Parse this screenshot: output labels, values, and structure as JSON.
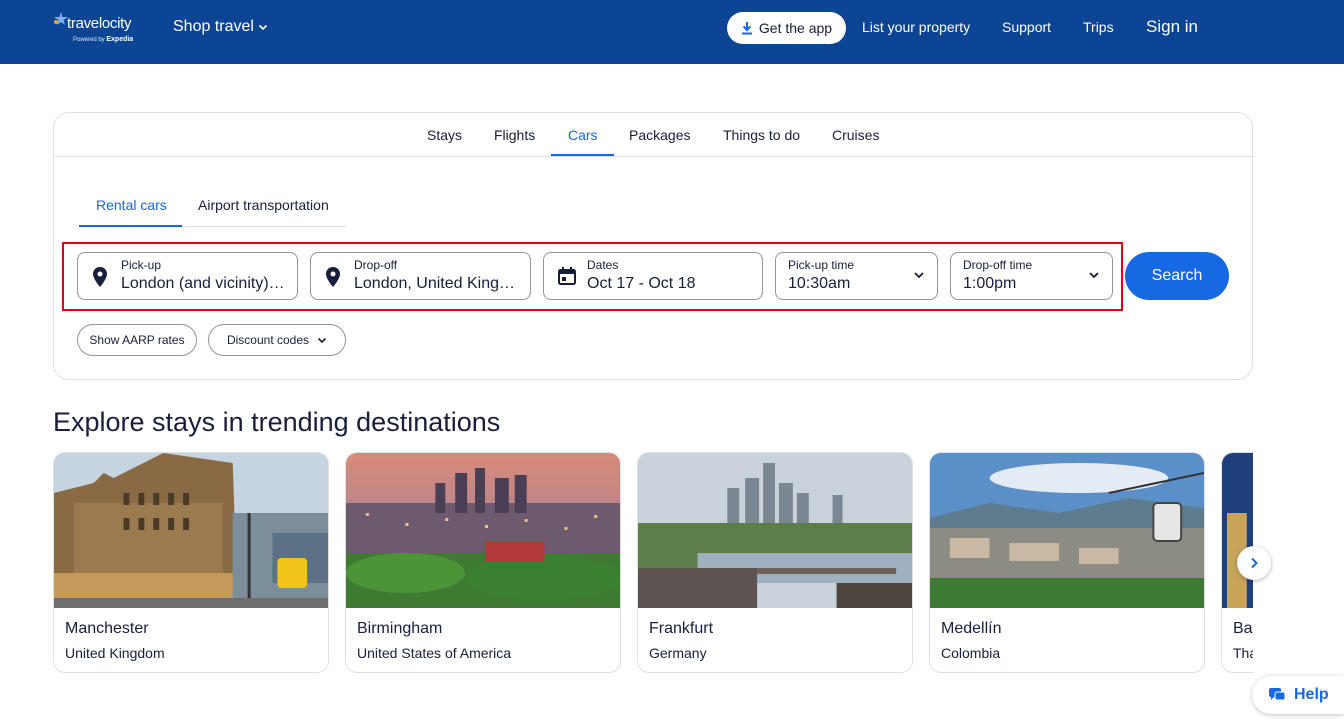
{
  "header": {
    "logo_name": "travelocity",
    "logo_powered": "Powered by",
    "logo_brand": "Expedia",
    "shop_travel": "Shop travel",
    "get_app": "Get the app",
    "list_property": "List your property",
    "support": "Support",
    "trips": "Trips",
    "sign_in": "Sign in",
    "bg_color": "#0d4595"
  },
  "tabs": [
    {
      "label": "Stays"
    },
    {
      "label": "Flights"
    },
    {
      "label": "Cars",
      "active": true
    },
    {
      "label": "Packages"
    },
    {
      "label": "Things to do"
    },
    {
      "label": "Cruises"
    }
  ],
  "subtabs": [
    {
      "label": "Rental cars",
      "active": true
    },
    {
      "label": "Airport transportation"
    }
  ],
  "form": {
    "pickup": {
      "label": "Pick-up",
      "value": "London (and vicinity)…",
      "icon": "map-pin-icon"
    },
    "dropoff": {
      "label": "Drop-off",
      "value": "London, United King…",
      "icon": "map-pin-icon"
    },
    "dates": {
      "label": "Dates",
      "value": "Oct 17 - Oct 18",
      "icon": "calendar-icon"
    },
    "pickup_time": {
      "label": "Pick-up time",
      "value": "10:30am"
    },
    "dropoff_time": {
      "label": "Drop-off time",
      "value": "1:00pm"
    },
    "search": "Search",
    "aarp": "Show AARP rates",
    "discount": "Discount codes",
    "accent_color": "#1668e3",
    "highlight_color": "#e60012"
  },
  "trending": {
    "heading": "Explore stays in trending destinations",
    "destinations": [
      {
        "city": "Manchester",
        "country": "United Kingdom"
      },
      {
        "city": "Birmingham",
        "country": "United States of America"
      },
      {
        "city": "Frankfurt",
        "country": "Germany"
      },
      {
        "city": "Medellín",
        "country": "Colombia"
      },
      {
        "city": "Ba",
        "country": "Tha"
      }
    ]
  },
  "help": "Help"
}
